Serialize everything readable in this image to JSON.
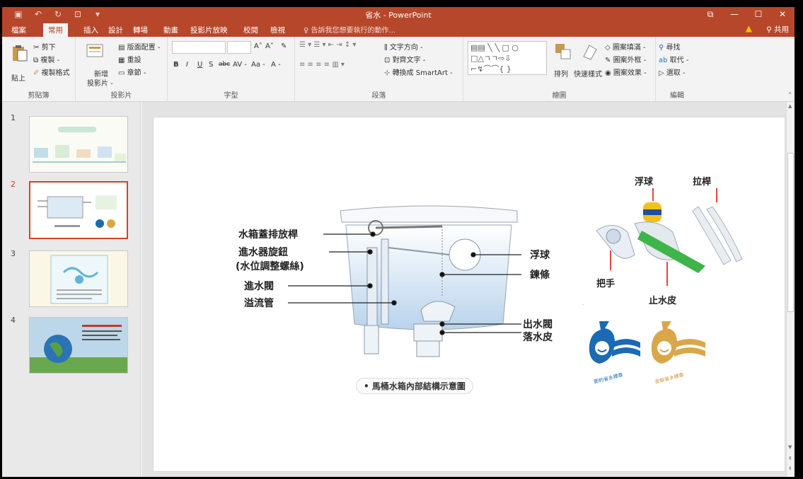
{
  "window": {
    "title": "省水 - PowerPoint",
    "share_label": "共用",
    "qat_icons": [
      "save-icon",
      "undo-icon",
      "redo-icon",
      "present-icon",
      "customize-icon"
    ]
  },
  "tabs": [
    {
      "label": "檔案",
      "active": false
    },
    {
      "label": "常用",
      "active": true
    },
    {
      "label": "插入",
      "active": false
    },
    {
      "label": "設計",
      "active": false
    },
    {
      "label": "轉場",
      "active": false
    },
    {
      "label": "動畫",
      "active": false
    },
    {
      "label": "投影片放映",
      "active": false
    },
    {
      "label": "校閱",
      "active": false
    },
    {
      "label": "檢視",
      "active": false
    }
  ],
  "tell_me": "告訴我您想要執行的動作...",
  "ribbon": {
    "clipboard": {
      "label": "剪貼簿",
      "paste": "貼上",
      "cut": "剪下",
      "copy": "複製 -",
      "format_painter": "複製格式"
    },
    "slides": {
      "label": "投影片",
      "new_slide": "新增",
      "new_slide2": "投影片 -",
      "layout": "版面配置 -",
      "reset": "重設",
      "section": "章節 -"
    },
    "font": {
      "label": "字型",
      "bold": "B",
      "italic": "I",
      "underline": "U",
      "strike": "S",
      "abc": "abc",
      "spacing": "AV -",
      "case": "Aa -",
      "color": "A -"
    },
    "paragraph": {
      "label": "段落",
      "text_direction": "文字方向 -",
      "align_text": "對齊文字 -",
      "smartart": "轉換成 SmartArt -"
    },
    "drawing": {
      "label": "繪圖",
      "arrange": "排列",
      "quick_styles": "快速樣式",
      "fill": "圖案填滿 -",
      "outline": "圖案外框 -",
      "effects": "圖案效果 -"
    },
    "editing": {
      "label": "編輯",
      "find": "尋找",
      "replace": "取代 -",
      "select": "選取 -"
    }
  },
  "thumbnails": [
    {
      "num": "1",
      "selected": false
    },
    {
      "num": "2",
      "selected": true
    },
    {
      "num": "3",
      "selected": false
    },
    {
      "num": "4",
      "selected": false
    }
  ],
  "slide": {
    "labels_left": {
      "lever": "水箱蓋排放桿",
      "inlet_knob": "進水器旋鈕",
      "inlet_knob_sub": "(水位調整螺絲)",
      "inlet_valve": "進水閥",
      "overflow": "溢流管"
    },
    "labels_right": {
      "float": "浮球",
      "chain": "鍊條",
      "outlet_valve": "出水閥",
      "flapper": "落水皮"
    },
    "caption": "• 馬桶水箱內部結構示意圖",
    "photo_labels": {
      "float": "浮球",
      "rod": "拉桿",
      "handle": "把手",
      "stopper": "止水皮"
    },
    "logo_blue_text": "節約省水標章",
    "logo_gold_text": "金級省水標章"
  },
  "colors": {
    "accent": "#b7472a",
    "selected_thumb": "#d04526",
    "logo_blue": "#1b6ab3",
    "logo_gold": "#d9a74a"
  }
}
